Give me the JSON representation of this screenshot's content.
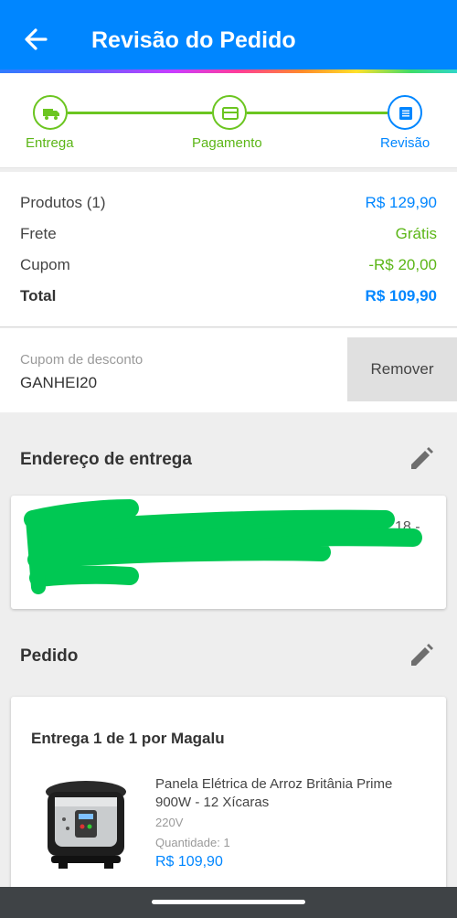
{
  "header": {
    "title": "Revisão do Pedido",
    "back_icon": "arrow-left-icon",
    "color": "#0086ff"
  },
  "steps": [
    {
      "label": "Entrega",
      "icon": "truck-icon",
      "state": "done"
    },
    {
      "label": "Pagamento",
      "icon": "credit-card-icon",
      "state": "done"
    },
    {
      "label": "Revisão",
      "icon": "list-icon",
      "state": "current"
    }
  ],
  "summary": {
    "products_label": "Produtos (1)",
    "products_value": "R$ 129,90",
    "shipping_label": "Frete",
    "shipping_value": "Grátis",
    "coupon_label": "Cupom",
    "coupon_value": "-R$ 20,00",
    "total_label": "Total",
    "total_value": "R$ 109,90"
  },
  "coupon": {
    "label": "Cupom de desconto",
    "code": "GANHEI20",
    "remove_label": "Remover"
  },
  "address": {
    "title": "Endereço de entrega",
    "visible_fragment": "18 -",
    "redacted": true
  },
  "order": {
    "title": "Pedido",
    "delivery_title": "Entrega 1 de 1 por Magalu",
    "product": {
      "name": "Panela Elétrica de Arroz Britânia Prime 900W - 12 Xícaras",
      "voltage": "220V",
      "quantity": "Quantidade:  1",
      "price": "R$ 109,90"
    }
  },
  "colors": {
    "accent": "#0086ff",
    "success": "#6bc520",
    "scribble": "#00c853"
  }
}
